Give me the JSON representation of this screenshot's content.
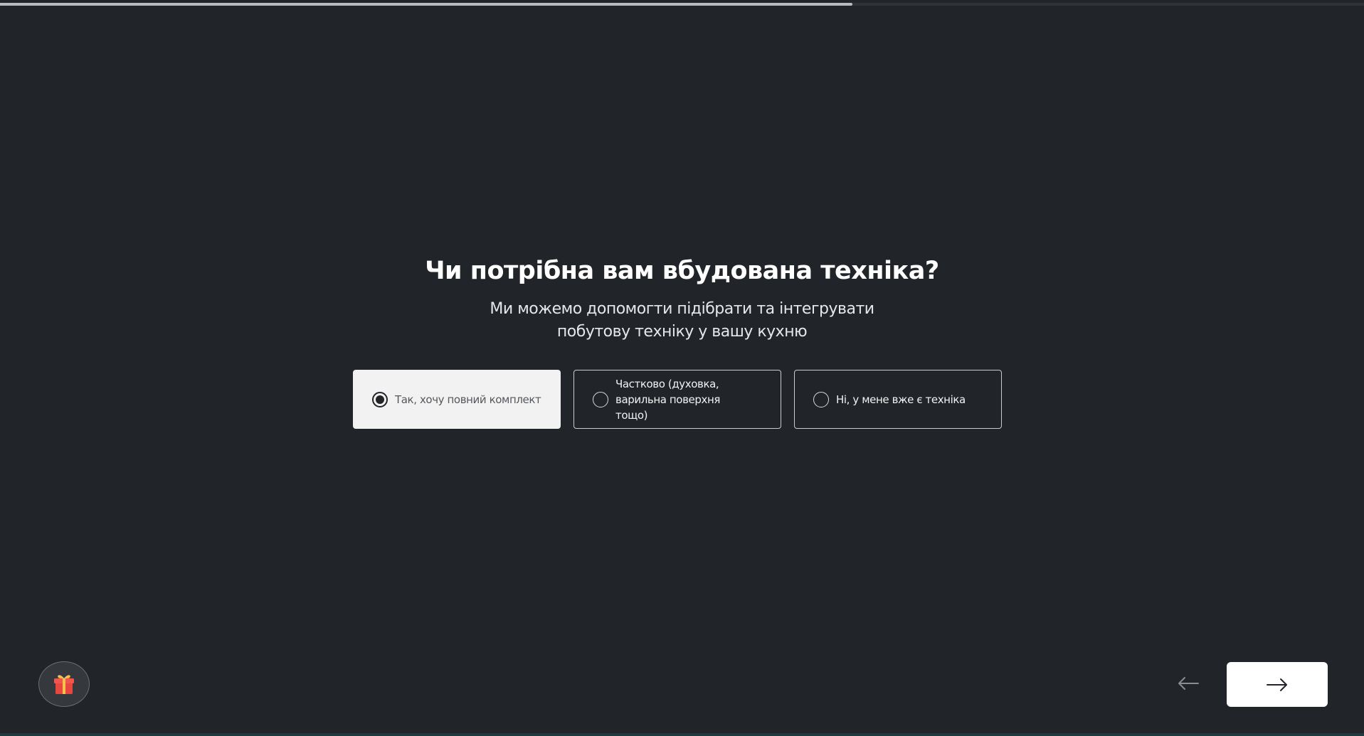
{
  "progress": {
    "value_percent": 62.5,
    "fill_color": "#b9bbbe"
  },
  "question": {
    "title": "Чи потрібна вам вбудована техніка?",
    "subtitle": "Ми можемо допомогти підібрати та інтегрувати побутову техніку у вашу кухню"
  },
  "options": [
    {
      "label": "Так, хочу повний комплект",
      "selected": true
    },
    {
      "label": "Частково (духовка, варильна поверхня тощо)",
      "selected": false
    },
    {
      "label": "Ні, у мене вже є техніка",
      "selected": false
    }
  ],
  "gift_button": {
    "icon": "gift-icon"
  },
  "navigation": {
    "back_icon": "arrow-left-icon",
    "next_icon": "arrow-right-icon"
  },
  "colors": {
    "background": "#212429",
    "selected_option_bg": "#f2f2f2",
    "next_button_bg": "#ffffff"
  }
}
